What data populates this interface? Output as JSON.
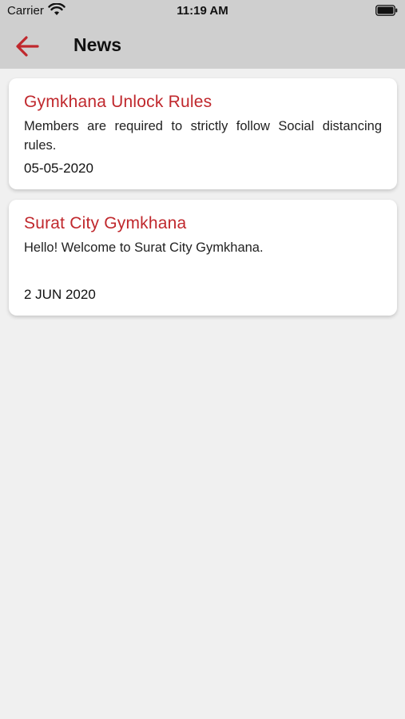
{
  "status_bar": {
    "carrier": "Carrier",
    "time": "11:19 AM",
    "wifi_icon": "wifi-icon",
    "battery_icon": "battery-icon"
  },
  "nav": {
    "back_icon": "arrow-left-icon",
    "title": "News",
    "accent_color": "#c0282d",
    "bar_color": "#cfcfcf"
  },
  "news": [
    {
      "title": "Gymkhana Unlock Rules",
      "body": "Members are required to strictly follow Social distancing rules.",
      "date": "05-05-2020"
    },
    {
      "title": "Surat City Gymkhana",
      "body": "Hello! Welcome to Surat City Gymkhana.",
      "date": "2 JUN 2020"
    }
  ]
}
